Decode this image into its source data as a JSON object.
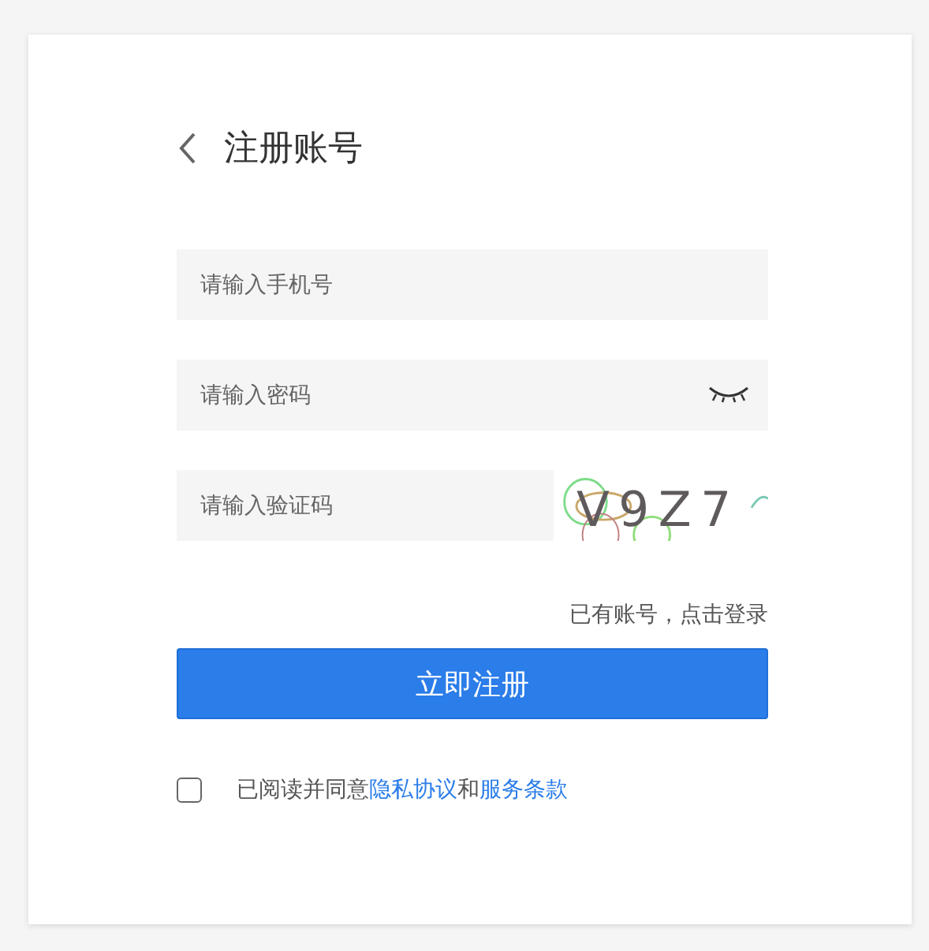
{
  "header": {
    "title": "注册账号"
  },
  "fields": [
    {
      "kind": "phone",
      "placeholder": "请输入手机号"
    },
    {
      "kind": "password",
      "placeholder": "请输入密码"
    },
    {
      "kind": "captcha",
      "placeholder": "请输入验证码",
      "code": "V9Z7"
    }
  ],
  "login_link": "已有账号，点击登录",
  "submit_button": "立即注册",
  "agreement": {
    "checked": false,
    "parts": [
      {
        "kind": "text",
        "text": "已阅读并同意"
      },
      {
        "kind": "link",
        "text": "隐私协议"
      },
      {
        "kind": "text",
        "text": "和"
      },
      {
        "kind": "link",
        "text": "服务条款"
      }
    ]
  }
}
